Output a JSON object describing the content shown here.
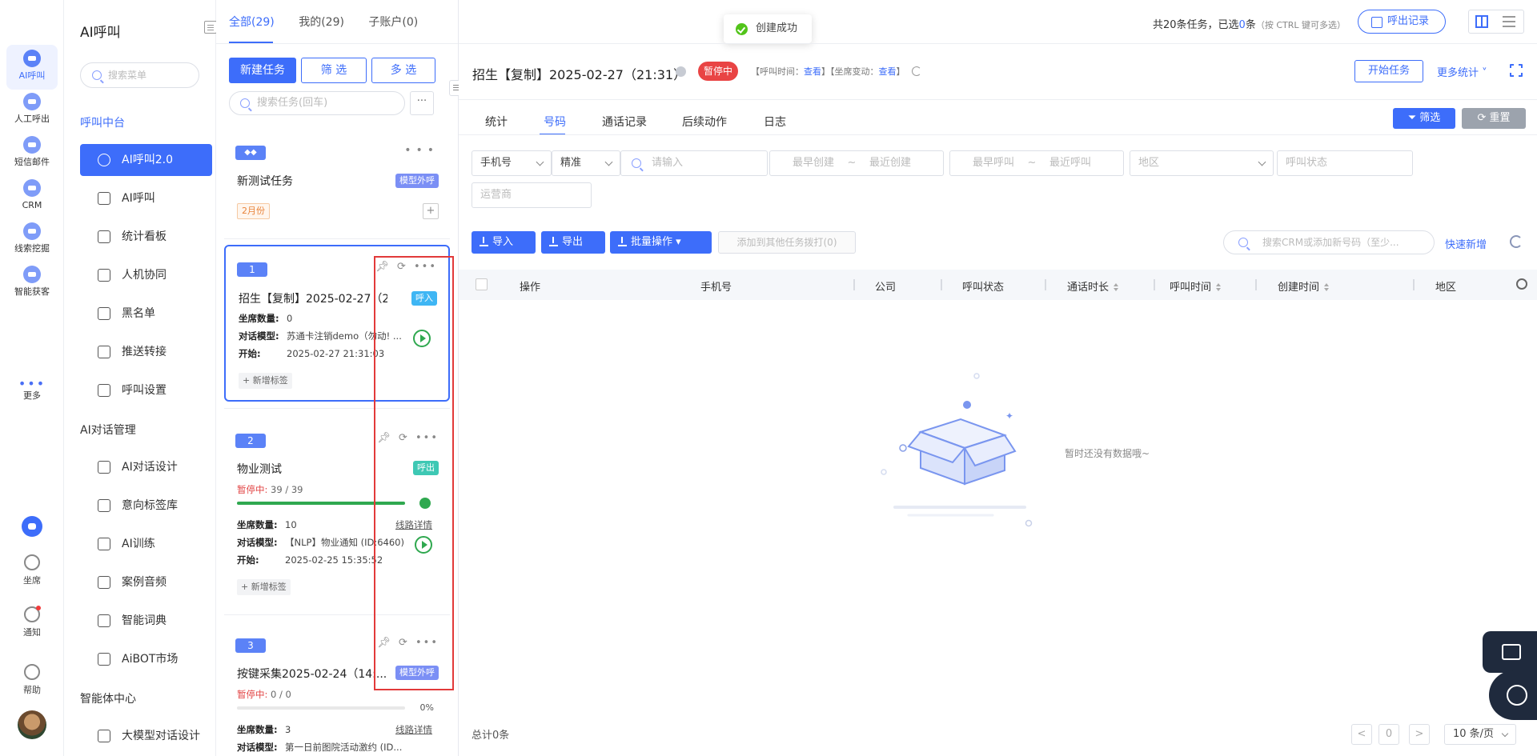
{
  "rail": {
    "items": [
      {
        "label": "AI呼叫",
        "icon": "ai-call-icon"
      },
      {
        "label": "人工呼出",
        "icon": "manual-call-icon"
      },
      {
        "label": "短信邮件",
        "icon": "sms-email-icon"
      },
      {
        "label": "CRM",
        "icon": "crm-icon"
      },
      {
        "label": "线索挖掘",
        "icon": "lead-mining-icon"
      },
      {
        "label": "智能获客",
        "icon": "smart-acquisition-icon"
      },
      {
        "label": "更多",
        "icon": "more-icon"
      }
    ],
    "bottom": [
      {
        "label": "坐席",
        "icon": "headset-icon"
      },
      {
        "label": "通知",
        "icon": "bell-icon"
      },
      {
        "label": "帮助",
        "icon": "help-icon"
      }
    ]
  },
  "menu": {
    "title": "AI呼叫",
    "search_placeholder": "搜索菜单",
    "group1": "呼叫中台",
    "group1_items": [
      "AI呼叫2.0",
      "AI呼叫",
      "统计看板",
      "人机协同",
      "黑名单",
      "推送转接",
      "呼叫设置"
    ],
    "group2": "AI对话管理",
    "group2_items": [
      "AI对话设计",
      "意向标签库",
      "AI训练",
      "案例音频",
      "智能词典",
      "AiBOT市场"
    ],
    "group3": "智能体中心",
    "group3_items": [
      "大模型对话设计"
    ]
  },
  "tasks": {
    "tabs": [
      "全部(29)",
      "我的(29)",
      "子账户(0)"
    ],
    "new_task": "新建任务",
    "filter": "筛 选",
    "multi": "多 选",
    "search_placeholder": "搜索任务(回车)",
    "more": "···",
    "cards": [
      {
        "badge": "",
        "title": "新测试任务",
        "tag": "模型外呼",
        "month": "2月份"
      },
      {
        "badge": "1",
        "title": "招生【复制】2025-02-27（21:...",
        "tag": "呼入",
        "seats_label": "坐席数量:",
        "seats": "0",
        "model_label": "对话模型:",
        "model": "苏通卡注销demo（勿动! ...",
        "start_label": "开始:",
        "start": "2025-02-27 21:31:03",
        "add_tag": "+ 新增标签"
      },
      {
        "badge": "2",
        "title": "物业测试",
        "tag": "呼出",
        "status": "暂停中:",
        "count": "39 / 39",
        "progress": 1.0,
        "seats_label": "坐席数量:",
        "seats": "10",
        "line_detail": "线路详情",
        "model_label": "对话模型:",
        "model": "【NLP】物业通知 (ID:6460)",
        "start_label": "开始:",
        "start": "2025-02-25 15:35:52",
        "add_tag": "+ 新增标签"
      },
      {
        "badge": "3",
        "title": "按键采集2025-02-24（14:...",
        "tag": "模型外呼",
        "status": "暂停中:",
        "count": "0 / 0",
        "progress": 0,
        "pct": "0%",
        "seats_label": "坐席数量:",
        "seats": "3",
        "line_detail": "线路详情",
        "model_label": "对话模型:",
        "model": "第一日前图院活动激约 (ID..."
      }
    ]
  },
  "toast": "创建成功",
  "summary": {
    "prefix": "共20条任务，已选",
    "selected": "0",
    "suffix": "条",
    "hint": "（按 CTRL 键可多选）"
  },
  "call_records": "呼出记录",
  "task": {
    "title": "招生【复制】2025-02-27（21:31）",
    "status": "暂停中",
    "meta_call_time": "【呼叫时间：",
    "meta_link1": "查看",
    "meta_seat_change": "】【坐席变动：",
    "meta_link2": "查看",
    "meta_end": "】",
    "start": "开始任务",
    "more_stats": "更多统计 ˅"
  },
  "sub_tabs": [
    "统计",
    "号码",
    "通话记录",
    "后续动作",
    "日志"
  ],
  "filter_btn": "筛选",
  "reset_btn": "重置",
  "filters": {
    "phone_field": "手机号",
    "match": "精准",
    "input_placeholder": "请输入",
    "created_from": "最早创建",
    "created_sep": "~",
    "created_to": "最近创建",
    "called_from": "最早呼叫",
    "called_sep": "~",
    "called_to": "最近呼叫",
    "region": "地区",
    "call_status": "呼叫状态",
    "carrier": "运营商"
  },
  "actions": {
    "import": "导入",
    "export": "导出",
    "batch": "批量操作 ▾",
    "add_to_other": "添加到其他任务拨打(0)",
    "crm_search_placeholder": "搜索CRM或添加新号码（至少...",
    "quick_add": "快速新增"
  },
  "columns": [
    "操作",
    "手机号",
    "公司",
    "呼叫状态",
    "通话时长",
    "呼叫时间",
    "创建时间",
    "地区"
  ],
  "empty": "暂时还没有数据哦~",
  "footer": {
    "total": "总计0条",
    "page": "0",
    "page_size": "10 条/页",
    "prev": "<",
    "next": ">"
  }
}
